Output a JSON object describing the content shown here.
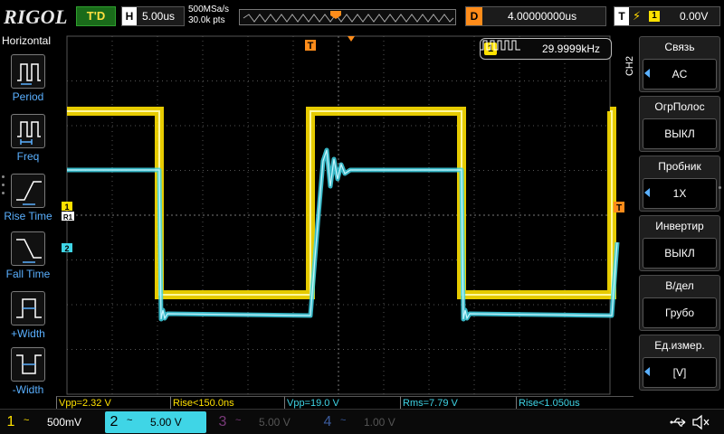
{
  "topbar": {
    "logo": "RIGOL",
    "run_state": "T'D",
    "horizontal": {
      "tag": "H",
      "value": "5.00us"
    },
    "sample_rate": "500MSa/s",
    "memory_depth": "30.0k pts",
    "delay": {
      "tag": "D",
      "value": "4.00000000us"
    },
    "trigger": {
      "tag": "T",
      "edge_icon": "rising-edge-icon",
      "source": "1",
      "level": "0.00V"
    }
  },
  "left_menu": {
    "title": "Horizontal",
    "items": [
      {
        "label": "Period",
        "icon": "period-icon"
      },
      {
        "label": "Freq",
        "icon": "freq-icon"
      },
      {
        "label": "Rise Time",
        "icon": "rise-time-icon"
      },
      {
        "label": "Fall Time",
        "icon": "fall-time-icon"
      },
      {
        "label": "+Width",
        "icon": "positive-width-icon"
      },
      {
        "label": "-Width",
        "icon": "negative-width-icon"
      }
    ]
  },
  "frequency_counter": {
    "channel": "1",
    "value": "29.9999kHz"
  },
  "markers": {
    "trigger_pos": "T",
    "ch1": "1",
    "ref": "R1",
    "ch2": "2",
    "trigger_level": "T"
  },
  "right_menu": {
    "side_label": "CH2",
    "items": [
      {
        "header": "Связь",
        "value": "AC",
        "has_arrow": true
      },
      {
        "header": "ОгрПолос",
        "value": "ВЫКЛ",
        "has_arrow": false
      },
      {
        "header": "Пробник",
        "value": "1X",
        "has_arrow": true
      },
      {
        "header": "Инвертир",
        "value": "ВЫКЛ",
        "has_arrow": false
      },
      {
        "header": "В/дел",
        "value": "Грубо",
        "has_arrow": false
      },
      {
        "header": "Ед.измер.",
        "value": "[V]",
        "has_arrow": true
      }
    ]
  },
  "measurements": [
    {
      "text": "Vpp=2.32 V",
      "channel": "1"
    },
    {
      "text": "Rise<150.0ns",
      "channel": "1"
    },
    {
      "text": "Vpp=19.0 V",
      "channel": "2"
    },
    {
      "text": "Rms=7.79 V",
      "channel": "2"
    },
    {
      "text": "Rise<1.050us",
      "channel": "2"
    }
  ],
  "channels": [
    {
      "num": "1",
      "coupling": "~",
      "scale": "500mV",
      "color": "#ffe100",
      "active": true
    },
    {
      "num": "2",
      "coupling": "~",
      "scale": "5.00 V",
      "color": "#3fd5e6",
      "active": true
    },
    {
      "num": "3",
      "coupling": "~",
      "scale": "5.00 V",
      "color": "#c040c0",
      "active": false
    },
    {
      "num": "4",
      "coupling": "~",
      "scale": "1.00 V",
      "color": "#4a7fe0",
      "active": false
    }
  ],
  "colors": {
    "ch1": "#ffe100",
    "ch2": "#3fd5e6",
    "trigger": "#ff8c1a",
    "menu_accent": "#5ab0ff"
  },
  "status_icons": [
    "usb-icon",
    "speaker-icon"
  ]
}
